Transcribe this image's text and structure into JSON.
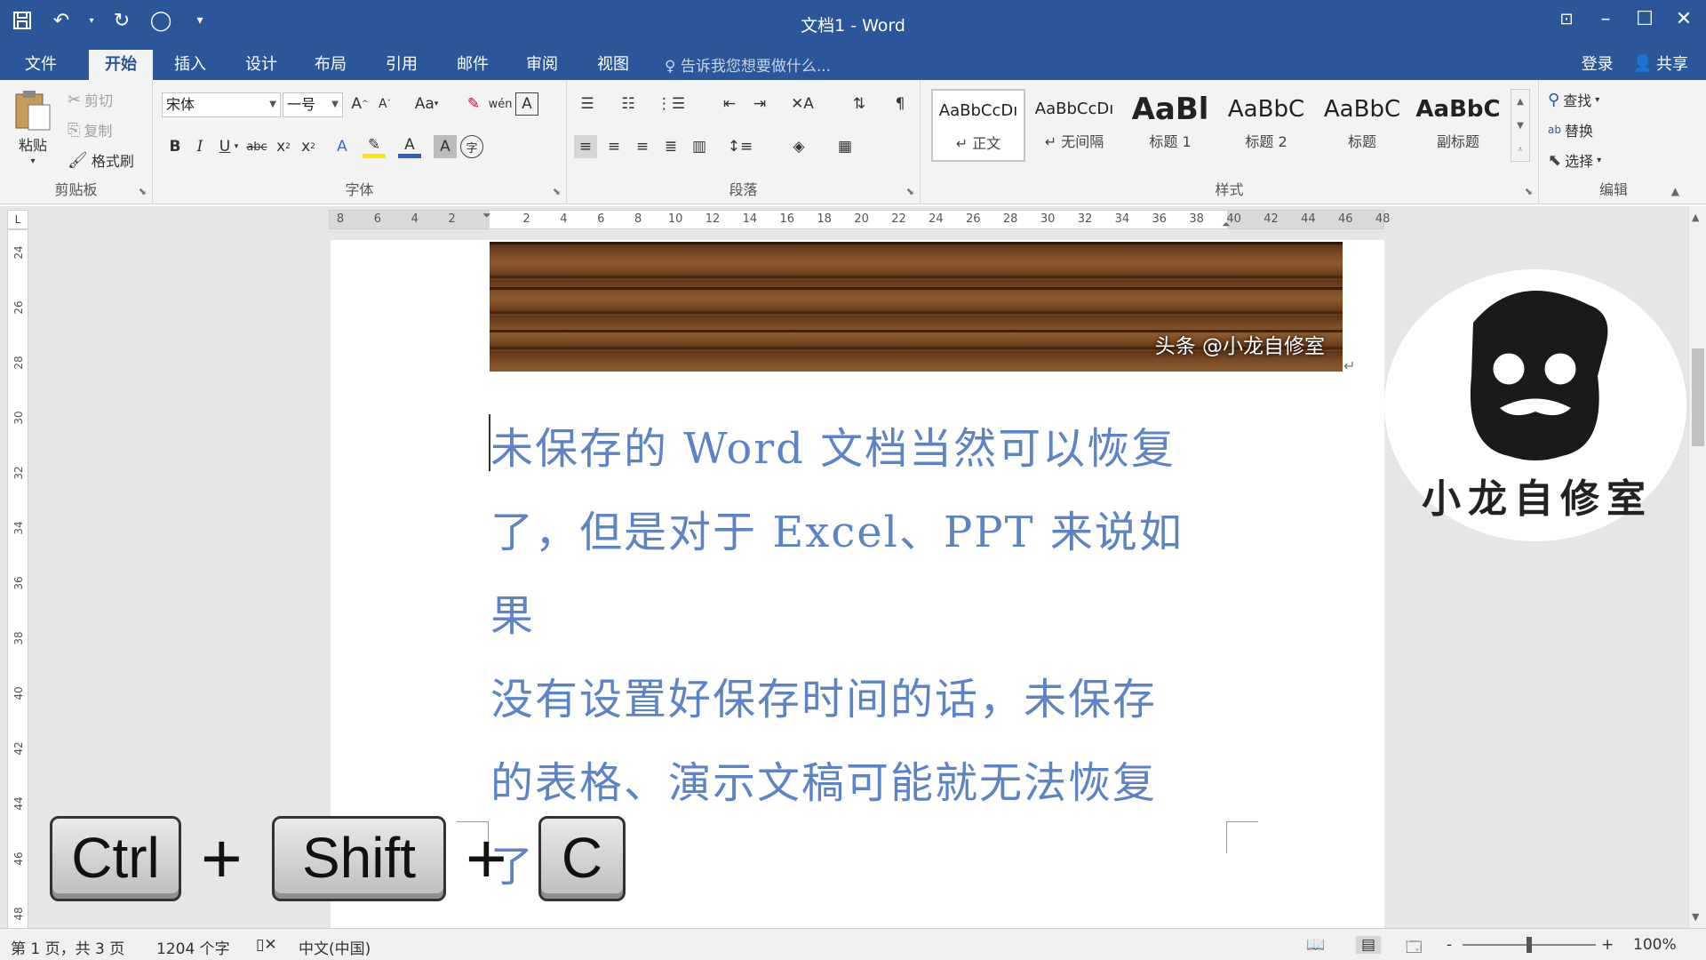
{
  "window": {
    "title": "文档1 - Word",
    "title_bar_color": "#2b579a"
  },
  "qat": {
    "save_icon": "save-icon",
    "undo_icon": "undo-icon",
    "redo_icon": "repeat-icon",
    "touch_icon": "touch-mode-icon",
    "customize_icon": "customize-qat-icon"
  },
  "tabs": [
    {
      "label": "文件"
    },
    {
      "label": "开始"
    },
    {
      "label": "插入"
    },
    {
      "label": "设计"
    },
    {
      "label": "布局"
    },
    {
      "label": "引用"
    },
    {
      "label": "邮件"
    },
    {
      "label": "审阅"
    },
    {
      "label": "视图"
    }
  ],
  "tell_me": "告诉我您想要做什么...",
  "account": {
    "signin": "登录",
    "share": "共享"
  },
  "ribbon": {
    "clipboard": {
      "label": "剪贴板",
      "paste": "粘贴",
      "cut": "剪切",
      "copy": "复制",
      "format_painter": "格式刷"
    },
    "font": {
      "label": "字体",
      "font_name": "宋体",
      "font_size": "一号",
      "case": "Aa"
    },
    "paragraph": {
      "label": "段落"
    },
    "styles": {
      "label": "样式",
      "items": [
        {
          "sample": "AaBbCcDı",
          "name": "↵ 正文"
        },
        {
          "sample": "AaBbCcDı",
          "name": "↵ 无间隔"
        },
        {
          "sample": "AaBl",
          "name": "标题 1"
        },
        {
          "sample": "AaBbC",
          "name": "标题 2"
        },
        {
          "sample": "AaBbC",
          "name": "标题"
        },
        {
          "sample": "AaBbC",
          "name": "副标题"
        }
      ]
    },
    "editing": {
      "label": "编辑",
      "find": "查找",
      "replace": "替换",
      "select": "选择"
    }
  },
  "ruler": {
    "h_ticks": [
      "8",
      "6",
      "4",
      "2",
      "",
      "2",
      "4",
      "6",
      "8",
      "10",
      "12",
      "14",
      "16",
      "18",
      "20",
      "22",
      "24",
      "26",
      "28",
      "30",
      "32",
      "34",
      "36",
      "38",
      "40",
      "42",
      "44",
      "46",
      "48"
    ],
    "v_ticks": [
      "24",
      "26",
      "28",
      "30",
      "32",
      "34",
      "36",
      "38",
      "40",
      "42",
      "44",
      "46",
      "48"
    ],
    "corner": "L"
  },
  "document": {
    "banner_watermark": "头条 @小龙自修室",
    "lines": [
      "未保存的 Word 文档当然可以恢复",
      "了，但是对于 Excel、PPT 来说如果",
      "没有设置好保存时间的话，未保存",
      "的表格、演示文稿可能就无法恢复",
      "了！"
    ],
    "paragraph_mark": "↵",
    "text_color": "#5b83c6"
  },
  "avatar": {
    "label": "小龙自修室"
  },
  "shortcut": {
    "key1": "Ctrl",
    "key2": "Shift",
    "key3": "C",
    "plus": "+"
  },
  "status": {
    "page": "第 1 页，共 3 页",
    "words": "1204 个字",
    "language": "中文(中国)",
    "zoom": "100%",
    "zoom_minus": "-",
    "zoom_plus": "+"
  }
}
